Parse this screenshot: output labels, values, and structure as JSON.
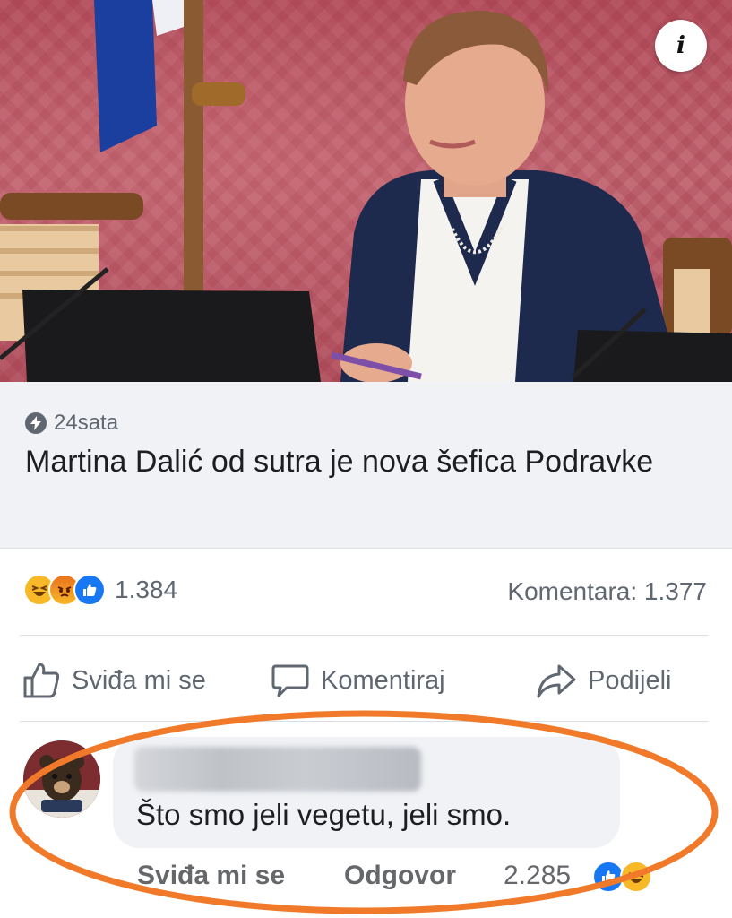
{
  "post": {
    "source_name": "24sata",
    "headline": "Martina Dalić od sutra je nova šefica Podravke"
  },
  "stats": {
    "reaction_count": "1.384",
    "reactions": [
      "haha",
      "angry",
      "like"
    ],
    "comments_label": "Komentara: 1.377"
  },
  "actions": {
    "like_label": "Sviđa mi se",
    "comment_label": "Komentiraj",
    "share_label": "Podijeli"
  },
  "comment": {
    "text": "Što smo jeli vegetu, jeli smo.",
    "like_label": "Sviđa mi se",
    "reply_label": "Odgovor",
    "reaction_count": "2.285",
    "reactions": [
      "like",
      "haha"
    ]
  },
  "colors": {
    "facebook_blue": "#1877f2",
    "annotation_orange": "#f07a2a",
    "muted_text": "#606770"
  }
}
